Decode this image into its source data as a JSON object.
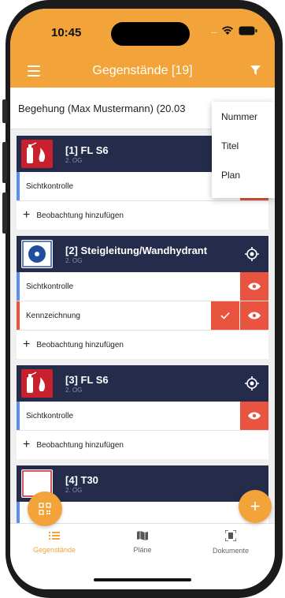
{
  "status": {
    "time": "10:45"
  },
  "nav": {
    "title": "Gegenstände [19]"
  },
  "inspection": {
    "label": "Begehung (Max Mustermann) (20.03"
  },
  "sort_menu": {
    "items": [
      "Nummer",
      "Titel",
      "Plan"
    ]
  },
  "colors": {
    "accent": "#f2a33a",
    "card_header": "#252c4b",
    "danger": "#e8543f",
    "obs_blue": "#5b8ff0"
  },
  "items": [
    {
      "title": "[1] FL S6",
      "floor": "2. OG",
      "thumb": "extinguisher-icon",
      "observations": [
        {
          "label": "Sichtkontrolle",
          "bar": "#5b8ff0",
          "check": false
        }
      ],
      "add_label": "Beobachtung hinzufügen",
      "locate": false
    },
    {
      "title": "[2] Steigleitung/Wandhydrant",
      "floor": "2. OG",
      "thumb": "hydrant-icon",
      "observations": [
        {
          "label": "Sichtkontrolle",
          "bar": "#5b8ff0",
          "check": false
        },
        {
          "label": "Kennzeichnung",
          "bar": "#e8543f",
          "check": true
        }
      ],
      "add_label": "Beobachtung hinzufügen",
      "locate": true
    },
    {
      "title": "[3] FL S6",
      "floor": "2. OG",
      "thumb": "extinguisher-icon",
      "observations": [
        {
          "label": "Sichtkontrolle",
          "bar": "#5b8ff0",
          "check": false
        }
      ],
      "add_label": "Beobachtung hinzufügen",
      "locate": true
    },
    {
      "title": "[4] T30",
      "floor": "2. OG",
      "thumb": "door-icon",
      "observations": [],
      "add_label": "",
      "locate": false
    }
  ],
  "tabs": [
    {
      "label": "Gegenstände",
      "icon": "list-icon",
      "active": true
    },
    {
      "label": "Pläne",
      "icon": "map-icon",
      "active": false
    },
    {
      "label": "Dokumente",
      "icon": "document-scan-icon",
      "active": false
    }
  ]
}
